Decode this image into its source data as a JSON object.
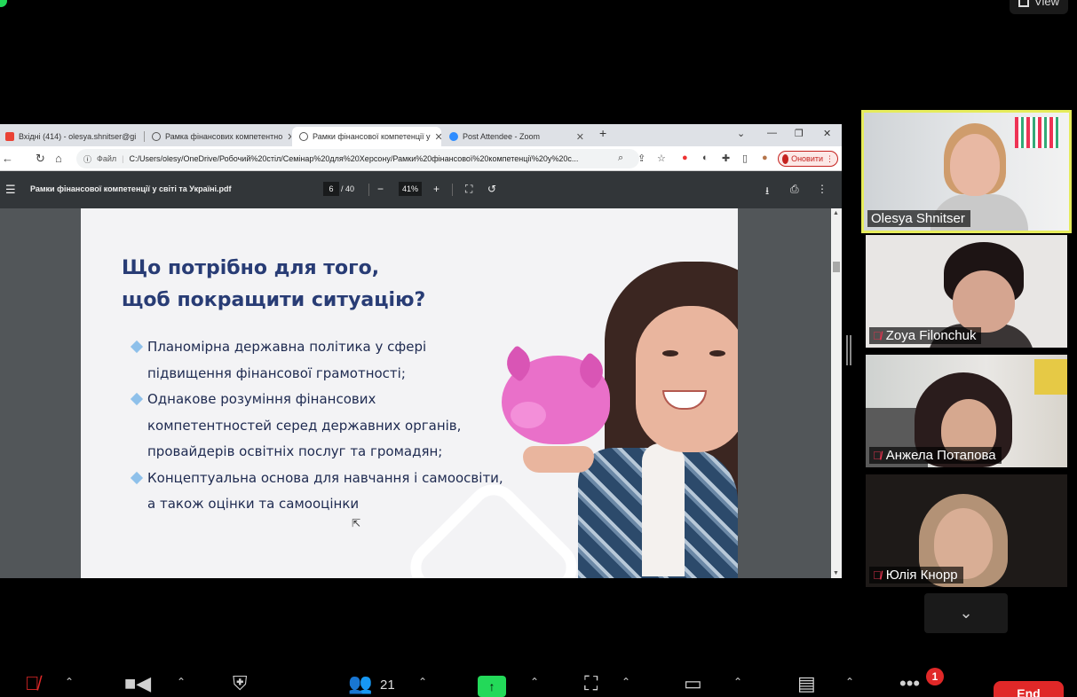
{
  "zoom": {
    "view_label": "View",
    "participants_count": "21",
    "more_badge": "1",
    "end_label": "End"
  },
  "browser": {
    "tabs": [
      {
        "label": "Вхідні (414) - olesya.shnitser@gi",
        "icon": "gmail-icon"
      },
      {
        "label": "Рамка фінансових компетентно",
        "icon": "globe-icon"
      },
      {
        "label": "Рамки фінансової компетенції у",
        "icon": "globe-icon"
      },
      {
        "label": "Post Attendee - Zoom",
        "icon": "zoom-icon"
      }
    ],
    "address_prefix": "Файл",
    "address": "C:/Users/olesy/OneDrive/Робочий%20стіл/Семінар%20для%20Херсону/Рамки%20фінансової%20компетенції%20у%20с...",
    "update_label": "Оновити"
  },
  "pdf": {
    "filename": "Рамки фінансової компетенції у світі та Україні.pdf",
    "page_current": "6",
    "page_total": "/ 40",
    "zoom_level": "41%"
  },
  "slide": {
    "title_line1": "Що потрібно для того,",
    "title_line2": "щоб покращити ситуацію?",
    "bullets": [
      "Планомірна державна політика у сфері підвищення фінансової грамотності;",
      "Однакове розуміння фінансових компетентностей серед державних органів, провайдерів освітніх послуг та громадян;",
      "Концептуальна основа для навчання і самоосвіти, а також оцінки та самооцінки"
    ]
  },
  "participants": [
    {
      "name": "Olesya Shnitser",
      "muted": false,
      "active_speaker": true
    },
    {
      "name": "Zoya Filonchuk",
      "muted": true
    },
    {
      "name": "Анжела Потапова",
      "muted": true
    },
    {
      "name": "Юлія Кнорр",
      "muted": true
    }
  ],
  "colors": {
    "share_green": "#23d959",
    "speaker_border": "#e6ec5c",
    "end_red": "#e02828",
    "slide_title": "#283c75",
    "bullet_diamond": "#8ec0ea",
    "piggy_pink": "#e970c9"
  }
}
